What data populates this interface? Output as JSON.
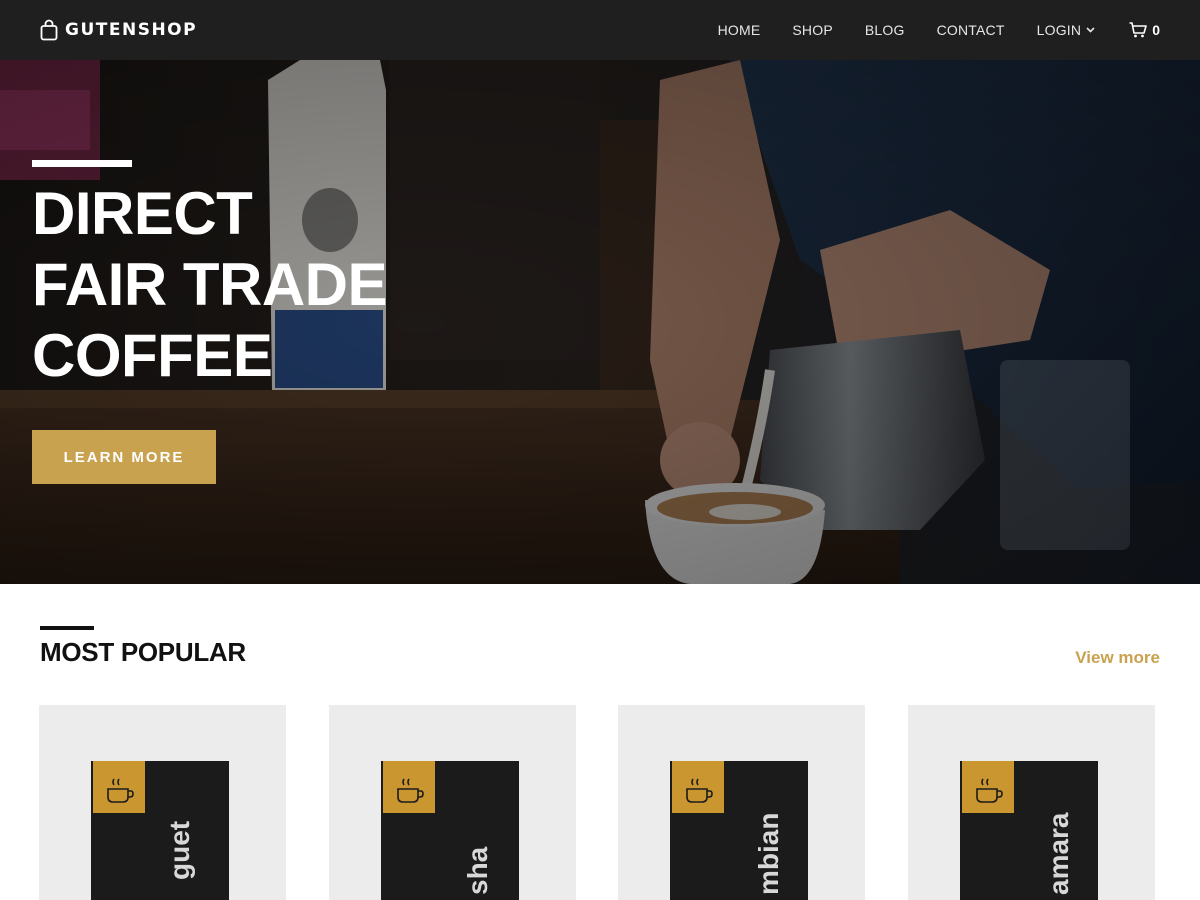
{
  "brand": {
    "name": "GUTENSHOP",
    "icon": "shopping-bag-icon"
  },
  "nav": {
    "items": [
      {
        "label": "HOME"
      },
      {
        "label": "SHOP"
      },
      {
        "label": "BLOG"
      },
      {
        "label": "CONTACT"
      },
      {
        "label": "LOGIN",
        "icon": "chevron-down-icon"
      }
    ],
    "cart": {
      "icon": "shopping-cart-icon",
      "count": "0"
    }
  },
  "hero": {
    "title_lines": [
      "DIRECT",
      "FAIR TRADE",
      "COFFEE"
    ],
    "button_label": "LEARN MORE",
    "accent_color": "#c9a24f"
  },
  "popular": {
    "title": "MOST POPULAR",
    "view_more": "View more",
    "products": [
      {
        "bag_text": "guet",
        "icon": "coffee-cup-icon"
      },
      {
        "bag_text": "sha",
        "icon": "coffee-cup-icon"
      },
      {
        "bag_text": "mbian",
        "icon": "coffee-cup-icon"
      },
      {
        "bag_text": "amara",
        "icon": "coffee-cup-icon"
      }
    ]
  },
  "colors": {
    "nav_bg": "#1f1f1f",
    "accent": "#c9a24f",
    "card_bg": "#ececec"
  }
}
